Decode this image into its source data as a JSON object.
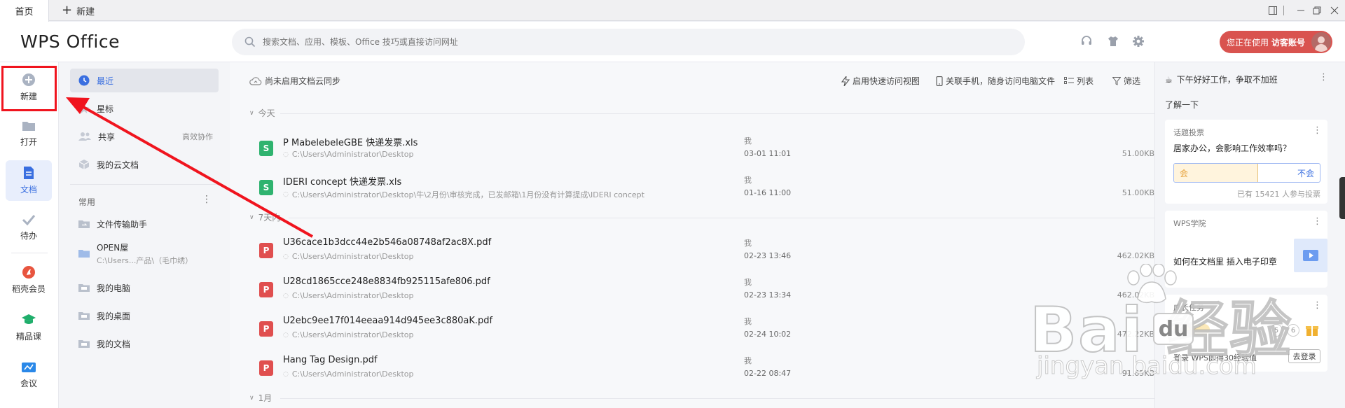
{
  "titlebar": {
    "home_tab": "首页",
    "new_tab": "新建"
  },
  "header": {
    "logo": "WPS Office",
    "search_placeholder": "搜索文档、应用、模板、Office 技巧或直接访问网址",
    "account_prefix": "您正在使用",
    "account_name": "访客账号"
  },
  "rail": {
    "items": [
      {
        "label": "新建",
        "icon": "plus-circle-icon"
      },
      {
        "label": "打开",
        "icon": "folder-icon"
      },
      {
        "label": "文档",
        "icon": "document-icon"
      },
      {
        "label": "待办",
        "icon": "check-icon"
      },
      {
        "label": "稻壳会员",
        "icon": "docer-icon"
      },
      {
        "label": "精品课",
        "icon": "graduation-cap-icon"
      },
      {
        "label": "会议",
        "icon": "meeting-icon"
      }
    ]
  },
  "nav": {
    "recent": "最近",
    "star": "星标",
    "shared": "共享",
    "shared_right": "高效协作",
    "cloud": "我的云文档",
    "common_heading": "常用",
    "common": [
      {
        "label": "文件传输助手",
        "sub": ""
      },
      {
        "label": "OPEN屋",
        "sub": "C:\\Users...产品\\（毛巾绣）"
      },
      {
        "label": "我的电脑",
        "sub": ""
      },
      {
        "label": "我的桌面",
        "sub": ""
      },
      {
        "label": "我的文档",
        "sub": ""
      }
    ]
  },
  "toolbar": {
    "sync": "尚未启用文档云同步",
    "quick_view": "启用快速访问视图",
    "phone": "关联手机，随身访问电脑文件",
    "list": "列表",
    "filter": "筛选"
  },
  "groups": {
    "today": "今天",
    "week": "7天内",
    "month": "1月"
  },
  "files": [
    {
      "name": "P MabelebeleGBE 快递发票.xls",
      "path": "C:\\Users\\Administrator\\Desktop",
      "owner": "我",
      "date": "03-01 11:01",
      "size": "51.00KB",
      "type": "xls"
    },
    {
      "name": "IDERI concept 快递发票.xls",
      "path": "C:\\Users\\Administrator\\Desktop\\牛\\2月份\\审核完成，已发邮箱\\1月份没有计算提成\\IDERI concept",
      "owner": "我",
      "date": "01-16 11:00",
      "size": "51.00KB",
      "type": "xls"
    },
    {
      "name": "U36cace1b3dcc44e2b546a08748af2ac8X.pdf",
      "path": "C:\\Users\\Administrator\\Desktop",
      "owner": "我",
      "date": "02-23 13:46",
      "size": "462.02KB",
      "type": "pdf"
    },
    {
      "name": "U28cd1865cce248e8834fb925115afe806.pdf",
      "path": "C:\\Users\\Administrator\\Desktop",
      "owner": "我",
      "date": "02-23 13:34",
      "size": "462.02KB",
      "type": "pdf"
    },
    {
      "name": "U2ebc9ee17f014eeaa914d945ee3c880aK.pdf",
      "path": "C:\\Users\\Administrator\\Desktop",
      "owner": "我",
      "date": "02-24 10:02",
      "size": "472.22KB",
      "type": "pdf"
    },
    {
      "name": "Hang Tag Design.pdf",
      "path": "C:\\Users\\Administrator\\Desktop",
      "owner": "我",
      "date": "02-22 08:47",
      "size": "91.65KB",
      "type": "pdf"
    }
  ],
  "right": {
    "greeting": "下午好好工作，争取不加班",
    "learn": "了解一下",
    "poll_title": "话题投票",
    "poll_question": "居家办公，会影响工作效率吗？",
    "poll_yes": "会",
    "poll_no": "不会",
    "poll_count": "已有 15421 人参与投票",
    "academy_title": "WPS学院",
    "academy_text": "如何在文档里 插入电子印章",
    "tasks_title": "成长任务",
    "tasks_steps": [
      "5",
      "6"
    ],
    "tasks_text": "登录 WPS即得30经验值",
    "login_button": "去登录"
  },
  "watermark": {
    "big": "Bai  经验",
    "small": "jingyan.baidu.com",
    "du": "du"
  },
  "colors": {
    "accent": "#3a6fe0",
    "red": "#d9534f",
    "xls": "#2fb36f",
    "pdf": "#e04f4f",
    "arrow": "#f0141e"
  }
}
